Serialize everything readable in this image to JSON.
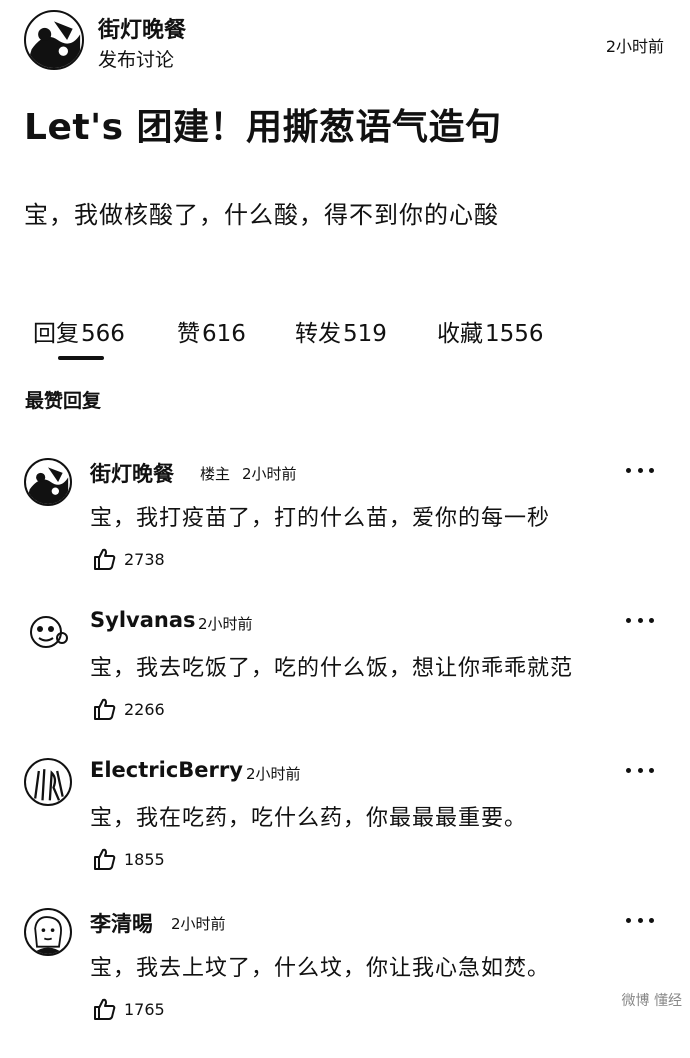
{
  "post": {
    "author": "街灯晚餐",
    "action": "发布讨论",
    "time": "2小时前",
    "title": "Let's 团建！用撕葱语气造句",
    "body": "宝，我做核酸了，什么酸，得不到你的心酸"
  },
  "tabs": [
    {
      "label": "回复",
      "count": "566"
    },
    {
      "label": "赞",
      "count": "616"
    },
    {
      "label": "转发",
      "count": "519"
    },
    {
      "label": "收藏",
      "count": "1556"
    }
  ],
  "section_title": "最赞回复",
  "comments": [
    {
      "name": "街灯晚餐",
      "badge": "楼主",
      "time": "2小时前",
      "text": "宝，我打疫苗了，打的什么苗，爱你的每一秒",
      "likes": "2738",
      "avatar_icon": "street-lamp-avatar-icon"
    },
    {
      "name": "Sylvanas",
      "badge": "",
      "time": "2小时前",
      "text": "宝，我去吃饭了，吃的什么饭，想让你乖乖就范",
      "likes": "2266",
      "avatar_icon": "cartoon-face-avatar-icon"
    },
    {
      "name": "ElectricBerry",
      "badge": "",
      "time": "2小时前",
      "text": "宝，我在吃药，吃什么药，你最最最重要。",
      "likes": "1855",
      "avatar_icon": "sketch-avatar-icon"
    },
    {
      "name": "李清晹",
      "badge": "",
      "time": "2小时前",
      "text": "宝，我去上坟了，什么坟，你让我心急如焚。",
      "likes": "1765",
      "avatar_icon": "portrait-avatar-icon"
    }
  ],
  "watermark": "微博 懂经"
}
